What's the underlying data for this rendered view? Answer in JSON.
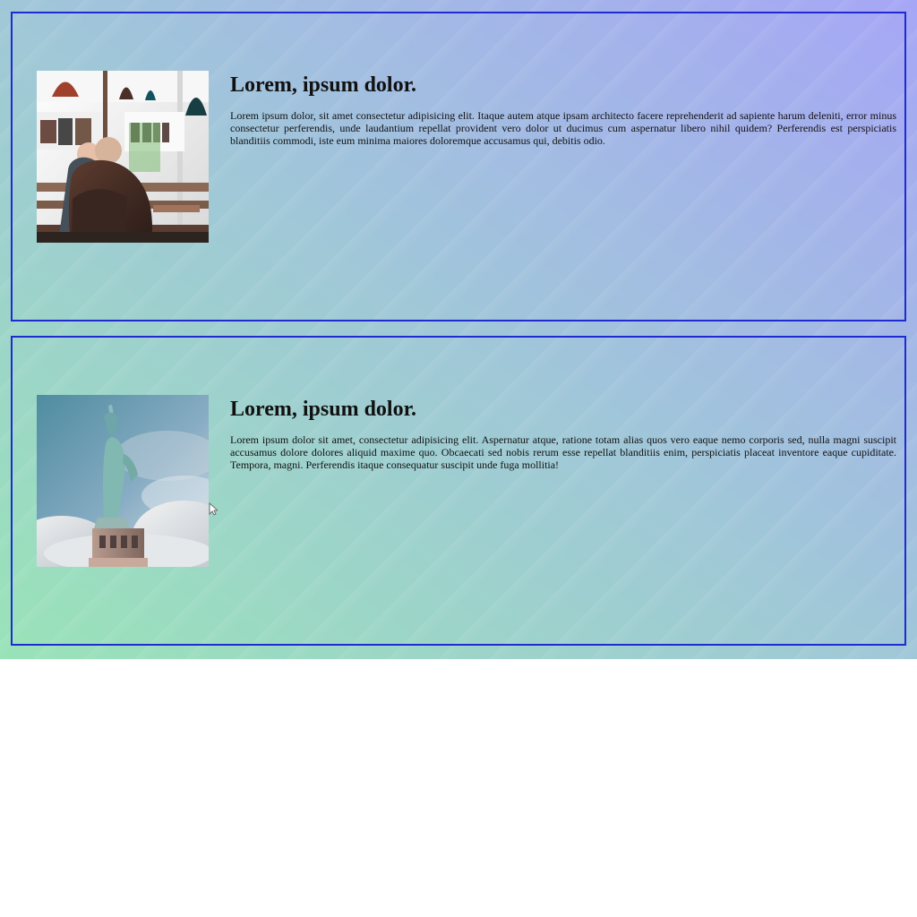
{
  "cards": [
    {
      "title": "Lorem, ipsum dolor.",
      "text": "Lorem ipsum dolor, sit amet consectetur adipisicing elit. Itaque autem atque ipsam architecto facere reprehenderit ad sapiente harum deleniti, error minus consectetur perferendis, unde laudantium repellat provident vero dolor ut ducimus cum aspernatur libero nihil quidem? Perferendis est perspiciatis blanditiis commodi, iste eum minima maiores doloremque accusamus qui, debitis odio.",
      "image": "cafe-interior-photo"
    },
    {
      "title": "Lorem, ipsum dolor.",
      "text": "Lorem ipsum dolor sit amet, consectetur adipisicing elit. Aspernatur atque, ratione totam alias quos vero eaque nemo corporis sed, nulla magni suscipit accusamus dolore dolores aliquid maxime quo. Obcaecati sed nobis rerum esse repellat blanditiis enim, perspiciatis placeat inventore eaque cupiditate. Tempora, magni. Perferendis itaque consequatur suscipit unde fuga mollitia!",
      "image": "statue-of-liberty-photo"
    }
  ],
  "colors": {
    "card_border": "#1f2bd1",
    "gradient_start": "#99e3b8",
    "gradient_mid": "#a0c7d8",
    "gradient_end": "#a6a6f6",
    "page_background": "#ffffff"
  },
  "cursor": "mouse-pointer-icon"
}
